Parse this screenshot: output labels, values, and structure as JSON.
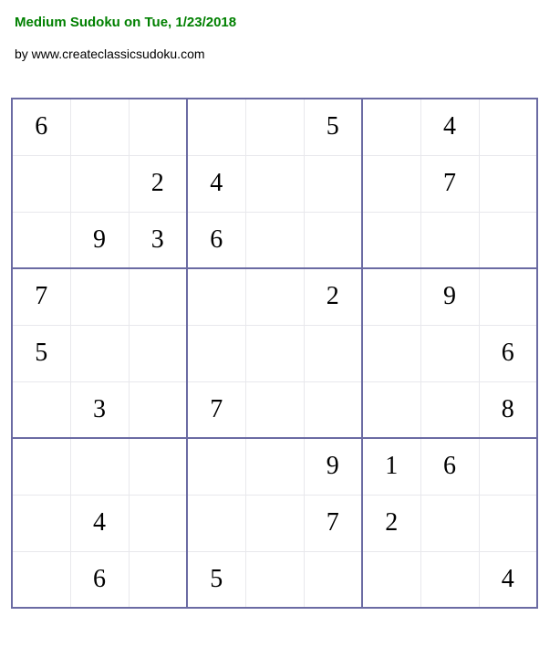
{
  "title": "Medium Sudoku on Tue, 1/23/2018",
  "byline": "by www.createclassicsudoku.com",
  "grid": [
    [
      "6",
      "",
      "",
      "",
      "",
      "5",
      "",
      "4",
      ""
    ],
    [
      "",
      "",
      "2",
      "4",
      "",
      "",
      "",
      "7",
      ""
    ],
    [
      "",
      "9",
      "3",
      "6",
      "",
      "",
      "",
      "",
      ""
    ],
    [
      "7",
      "",
      "",
      "",
      "",
      "2",
      "",
      "9",
      ""
    ],
    [
      "5",
      "",
      "",
      "",
      "",
      "",
      "",
      "",
      "6"
    ],
    [
      "",
      "3",
      "",
      "7",
      "",
      "",
      "",
      "",
      "8"
    ],
    [
      "",
      "",
      "",
      "",
      "",
      "9",
      "1",
      "6",
      ""
    ],
    [
      "",
      "4",
      "",
      "",
      "",
      "7",
      "2",
      "",
      ""
    ],
    [
      "",
      "6",
      "",
      "5",
      "",
      "",
      "",
      "",
      "4"
    ]
  ]
}
